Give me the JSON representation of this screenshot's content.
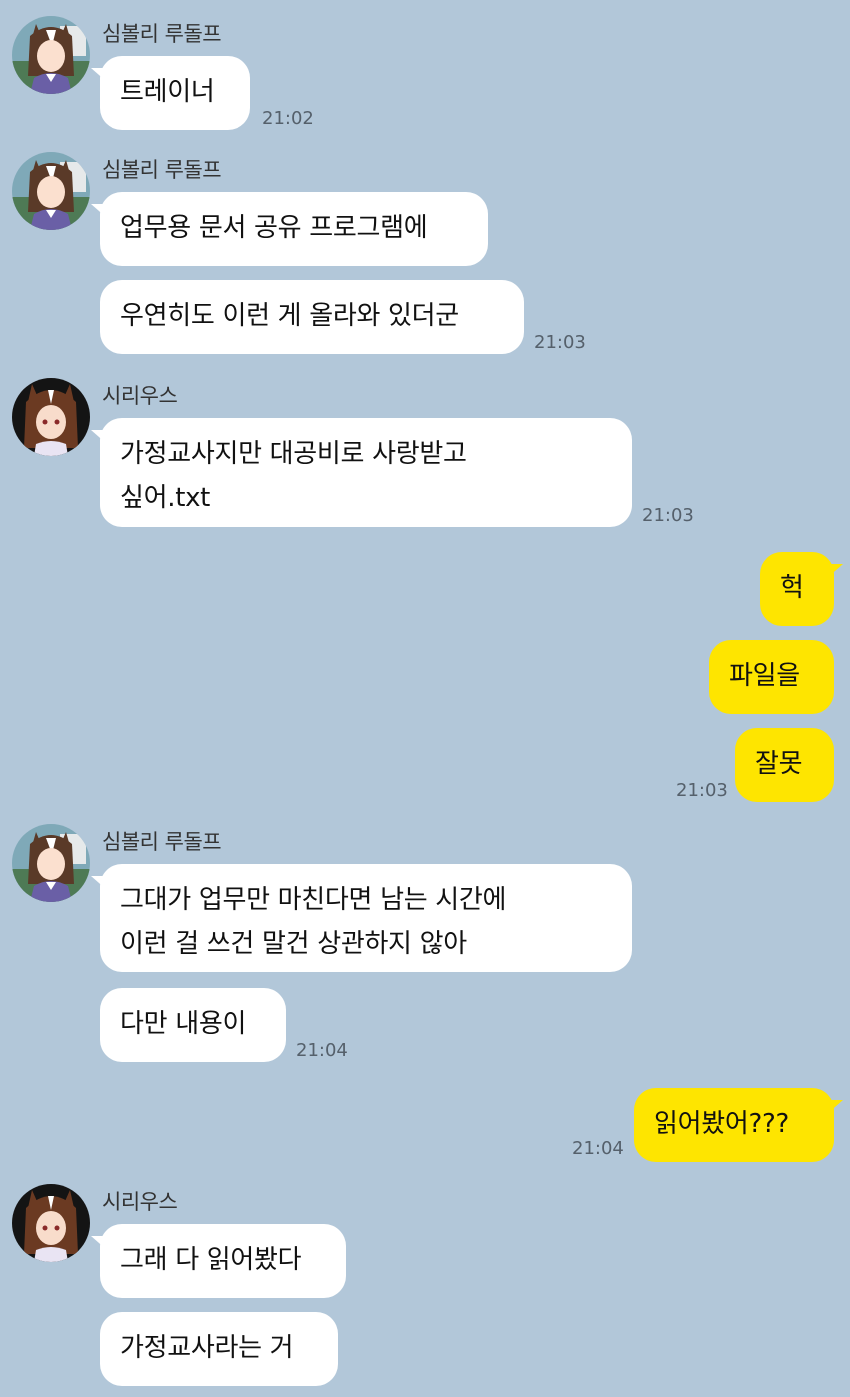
{
  "senders": {
    "symboli": "심볼리 루돌프",
    "sirius": "시리우스"
  },
  "messages": {
    "m1": "트레이너",
    "m2": "업무용 문서 공유 프로그램에",
    "m3": "우연히도 이런 게 올라와 있더군",
    "m4": "가정교사지만 대공비로 사랑받고\n싶어.txt",
    "m5": "헉",
    "m6": "파일을",
    "m7": "잘못",
    "m8": "그대가 업무만 마친다면 남는 시간에\n이런 걸 쓰건 말건 상관하지 않아",
    "m9": "다만 내용이",
    "m10": "읽어봤어???",
    "m11": "그래 다 읽어봤다",
    "m12": "가정교사라는 거"
  },
  "times": {
    "t1": "21:02",
    "t2": "21:03",
    "t3": "21:03",
    "t4": "21:03",
    "t5": "21:04",
    "t6": "21:04"
  },
  "colors": {
    "background": "#b2c7d9",
    "my_bubble": "#fee500",
    "their_bubble": "#ffffff"
  },
  "icons": {
    "symboli_avatar": "profile-avatar-symboli-rudolf",
    "sirius_avatar": "profile-avatar-sirius"
  }
}
